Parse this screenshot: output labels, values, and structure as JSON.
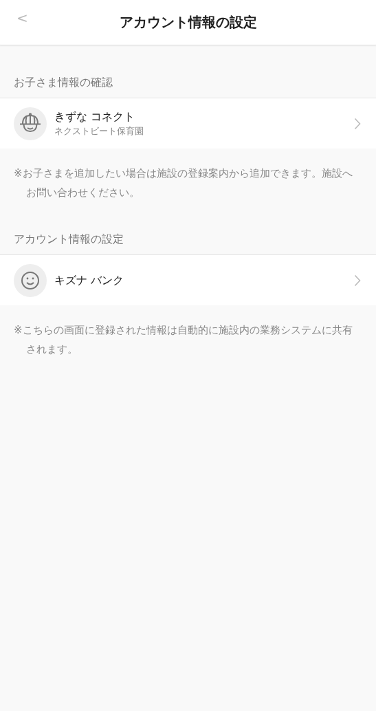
{
  "header": {
    "back": "<",
    "title": "アカウント情報の設定"
  },
  "sections": [
    {
      "title": "お子さま情報の確認",
      "items": [
        {
          "kind": "child",
          "name": "きずな コネクト",
          "sub": "ネクストビート保育園"
        }
      ],
      "note": "※お子さまを追加したい場合は施設の登録案内から追加できます。施設へお問い合わせください。"
    },
    {
      "title": "アカウント情報の設定",
      "items": [
        {
          "kind": "account",
          "name": "キズナ バンク"
        }
      ],
      "note": "※こちらの画面に登録された情報は自動的に施設内の業務システムに共有されます。"
    }
  ]
}
